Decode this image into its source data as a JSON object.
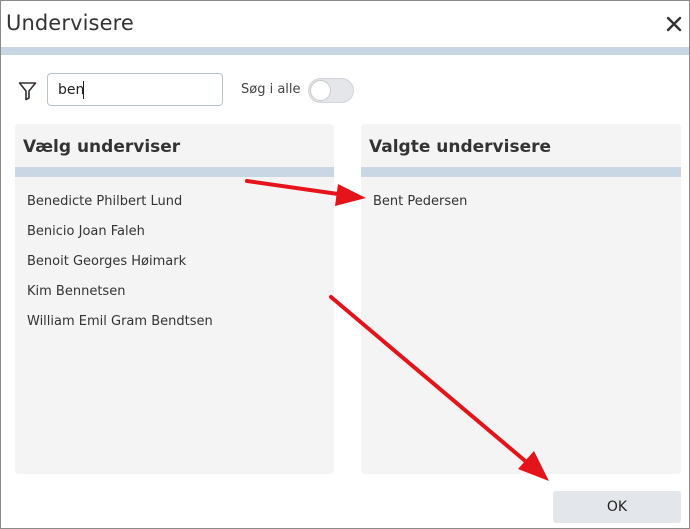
{
  "dialog": {
    "title": "Undervisere",
    "close_icon": "close-icon"
  },
  "filter": {
    "icon": "filter-icon",
    "search_value": "ben",
    "toggle_label": "Søg i alle",
    "toggle_on": false
  },
  "available": {
    "title": "Vælg underviser",
    "items": [
      "Benedicte Philbert Lund",
      "Benicio Joan Faleh",
      "Benoit Georges Høimark",
      "Kim Bennetsen",
      "William Emil Gram Bendtsen"
    ]
  },
  "selected": {
    "title": "Valgte undervisere",
    "items": [
      "Bent Pedersen"
    ]
  },
  "footer": {
    "ok_label": "OK"
  },
  "colors": {
    "accent_rule": "#c8d5e3",
    "annotation_arrow": "#e5141b",
    "panel_bg": "#f4f4f4",
    "button_bg": "#e3e6ea"
  }
}
